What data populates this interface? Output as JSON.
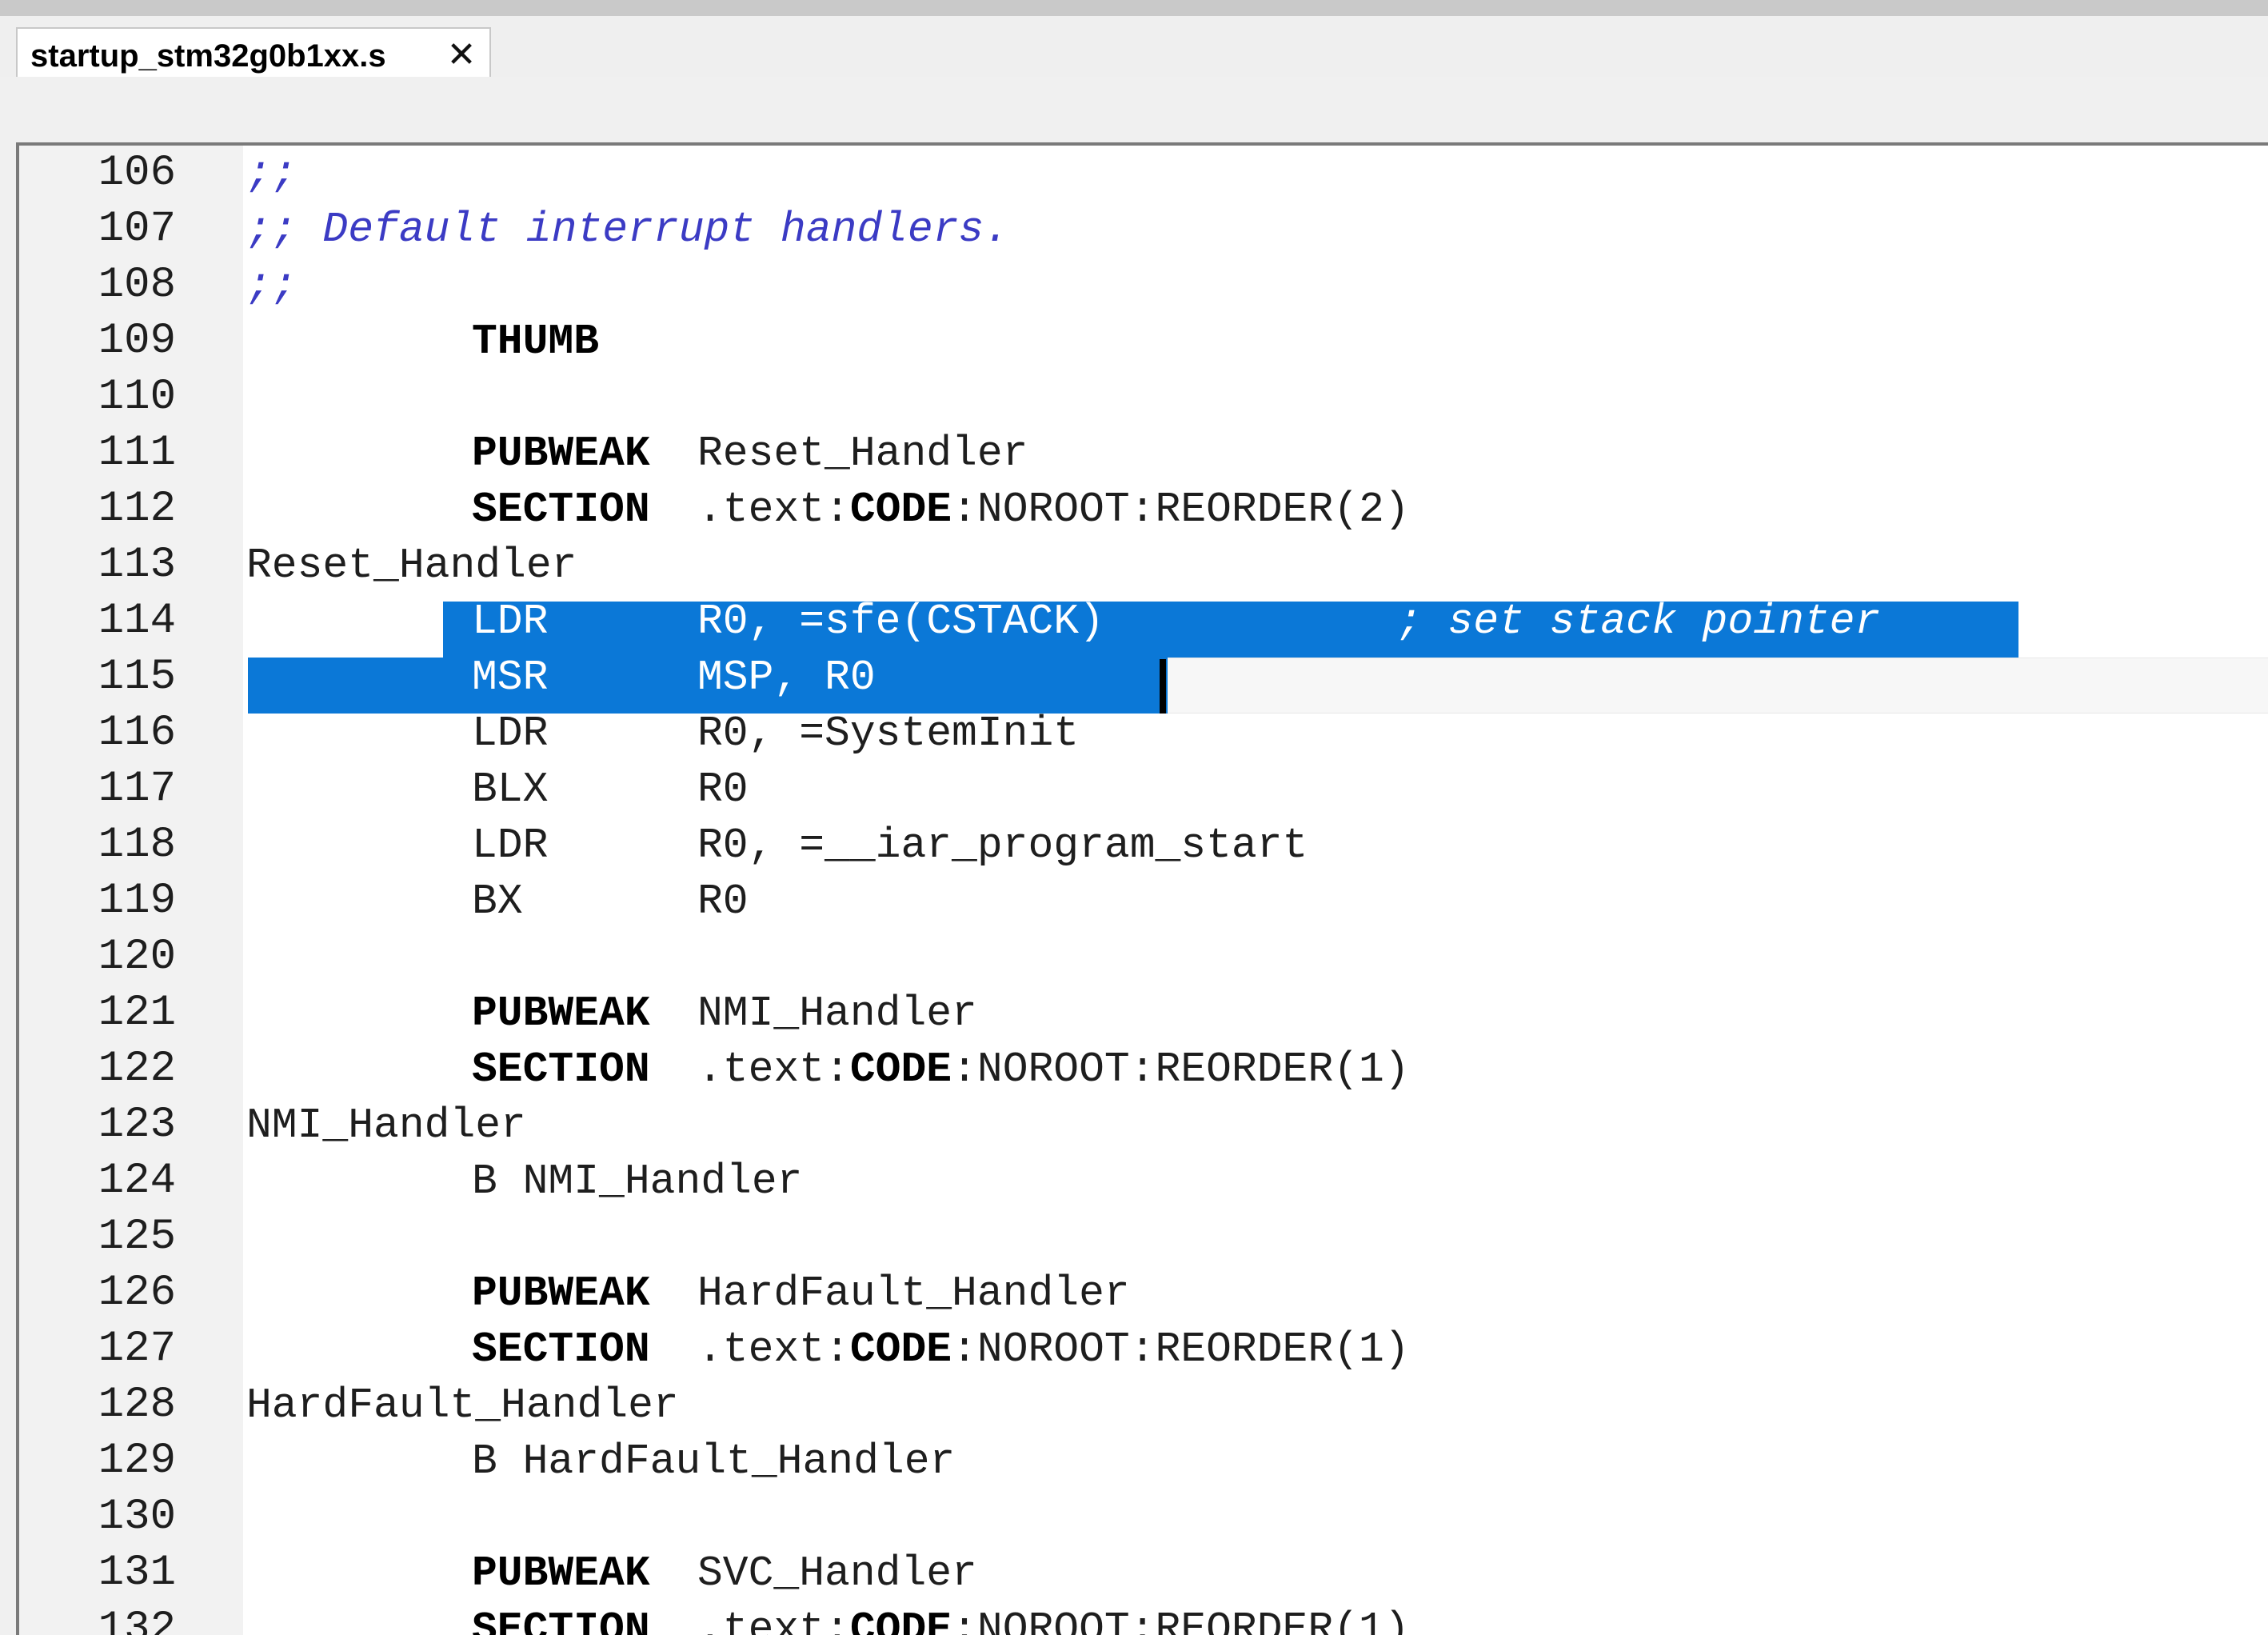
{
  "tab": {
    "filename": "startup_stm32g0b1xx.s",
    "close_glyph": "✕"
  },
  "editor": {
    "lines": [
      {
        "num": "106",
        "comment": ";;"
      },
      {
        "num": "107",
        "comment": ";; Default interrupt handlers."
      },
      {
        "num": "108",
        "comment": ";;"
      },
      {
        "num": "109",
        "keyword": "THUMB"
      },
      {
        "num": "110"
      },
      {
        "num": "111",
        "keyword": "PUBWEAK",
        "operand": "Reset_Handler"
      },
      {
        "num": "112",
        "keyword": "SECTION",
        "section_pre": ".text:",
        "section_code": "CODE",
        "section_post": ":NOROOT:REORDER(2)"
      },
      {
        "num": "113",
        "label": "Reset_Handler"
      },
      {
        "num": "114",
        "mnemonic": "LDR",
        "operand": "R0, =sfe(CSTACK)",
        "comment": "; set stack pointer"
      },
      {
        "num": "115",
        "mnemonic": "MSR",
        "operand": "MSP, R0"
      },
      {
        "num": "116",
        "mnemonic": "LDR",
        "operand": "R0, =SystemInit"
      },
      {
        "num": "117",
        "mnemonic": "BLX",
        "operand": "R0"
      },
      {
        "num": "118",
        "mnemonic": "LDR",
        "operand": "R0, =__iar_program_start"
      },
      {
        "num": "119",
        "mnemonic": "BX",
        "operand": "R0"
      },
      {
        "num": "120"
      },
      {
        "num": "121",
        "keyword": "PUBWEAK",
        "operand": "NMI_Handler"
      },
      {
        "num": "122",
        "keyword": "SECTION",
        "section_pre": ".text:",
        "section_code": "CODE",
        "section_post": ":NOROOT:REORDER(1)"
      },
      {
        "num": "123",
        "label": "NMI_Handler"
      },
      {
        "num": "124",
        "branch": "B NMI_Handler"
      },
      {
        "num": "125"
      },
      {
        "num": "126",
        "keyword": "PUBWEAK",
        "operand": "HardFault_Handler"
      },
      {
        "num": "127",
        "keyword": "SECTION",
        "section_pre": ".text:",
        "section_code": "CODE",
        "section_post": ":NOROOT:REORDER(1)"
      },
      {
        "num": "128",
        "label": "HardFault_Handler"
      },
      {
        "num": "129",
        "branch": "B HardFault_Handler"
      },
      {
        "num": "130"
      },
      {
        "num": "131",
        "keyword": "PUBWEAK",
        "operand": "SVC_Handler"
      },
      {
        "num": "132",
        "keyword": "SECTION",
        "section_pre": ".text:",
        "section_code": "CODE",
        "section_post": ":NOROOT:REORDER(1)"
      }
    ]
  },
  "colors": {
    "selection": "#0b78d7",
    "comment": "#3b3bc4",
    "gutter": "#f2f2f2"
  }
}
